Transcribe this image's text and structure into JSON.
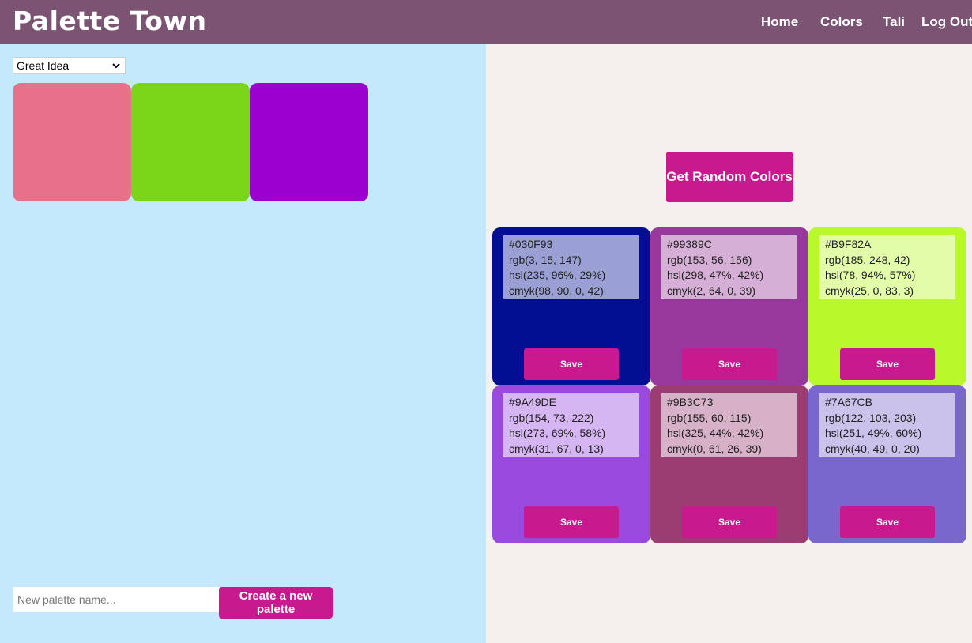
{
  "header": {
    "title": "Palette Town",
    "nav": [
      "Home",
      "Colors",
      "Tali",
      "Log Out"
    ]
  },
  "left": {
    "selected_palette": "Great Idea",
    "swatches": [
      {
        "color": "#e67189"
      },
      {
        "color": "#7bd518"
      },
      {
        "color": "#9b00d1"
      }
    ],
    "new_palette_placeholder": "New palette name...",
    "create_button_label": "Create a new palette"
  },
  "right": {
    "random_button_label": "Get Random Colors",
    "save_label": "Save",
    "cards": [
      {
        "bg": "#030f93",
        "hex": "#030F93",
        "rgb": "rgb(3, 15, 147)",
        "hsl": "hsl(235, 96%, 29%)",
        "cmyk": "cmyk(98, 90, 0, 42)"
      },
      {
        "bg": "#99389c",
        "hex": "#99389C",
        "rgb": "rgb(153, 56, 156)",
        "hsl": "hsl(298, 47%, 42%)",
        "cmyk": "cmyk(2, 64, 0, 39)"
      },
      {
        "bg": "#b9f82a",
        "hex": "#B9F82A",
        "rgb": "rgb(185, 248, 42)",
        "hsl": "hsl(78, 94%, 57%)",
        "cmyk": "cmyk(25, 0, 83, 3)"
      },
      {
        "bg": "#9a49de",
        "hex": "#9A49DE",
        "rgb": "rgb(154, 73, 222)",
        "hsl": "hsl(273, 69%, 58%)",
        "cmyk": "cmyk(31, 67, 0, 13)"
      },
      {
        "bg": "#9b3c73",
        "hex": "#9B3C73",
        "rgb": "rgb(155, 60, 115)",
        "hsl": "hsl(325, 44%, 42%)",
        "cmyk": "cmyk(0, 61, 26, 39)"
      },
      {
        "bg": "#7a67cb",
        "hex": "#7A67CB",
        "rgb": "rgb(122, 103, 203)",
        "hsl": "hsl(251, 49%, 60%)",
        "cmyk": "cmyk(40, 49, 0, 20)"
      }
    ]
  },
  "colors": {
    "header_bg": "#7b5473",
    "accent": "#c9198f",
    "left_bg": "#c4e9fc",
    "right_bg": "#f4f0eb"
  }
}
